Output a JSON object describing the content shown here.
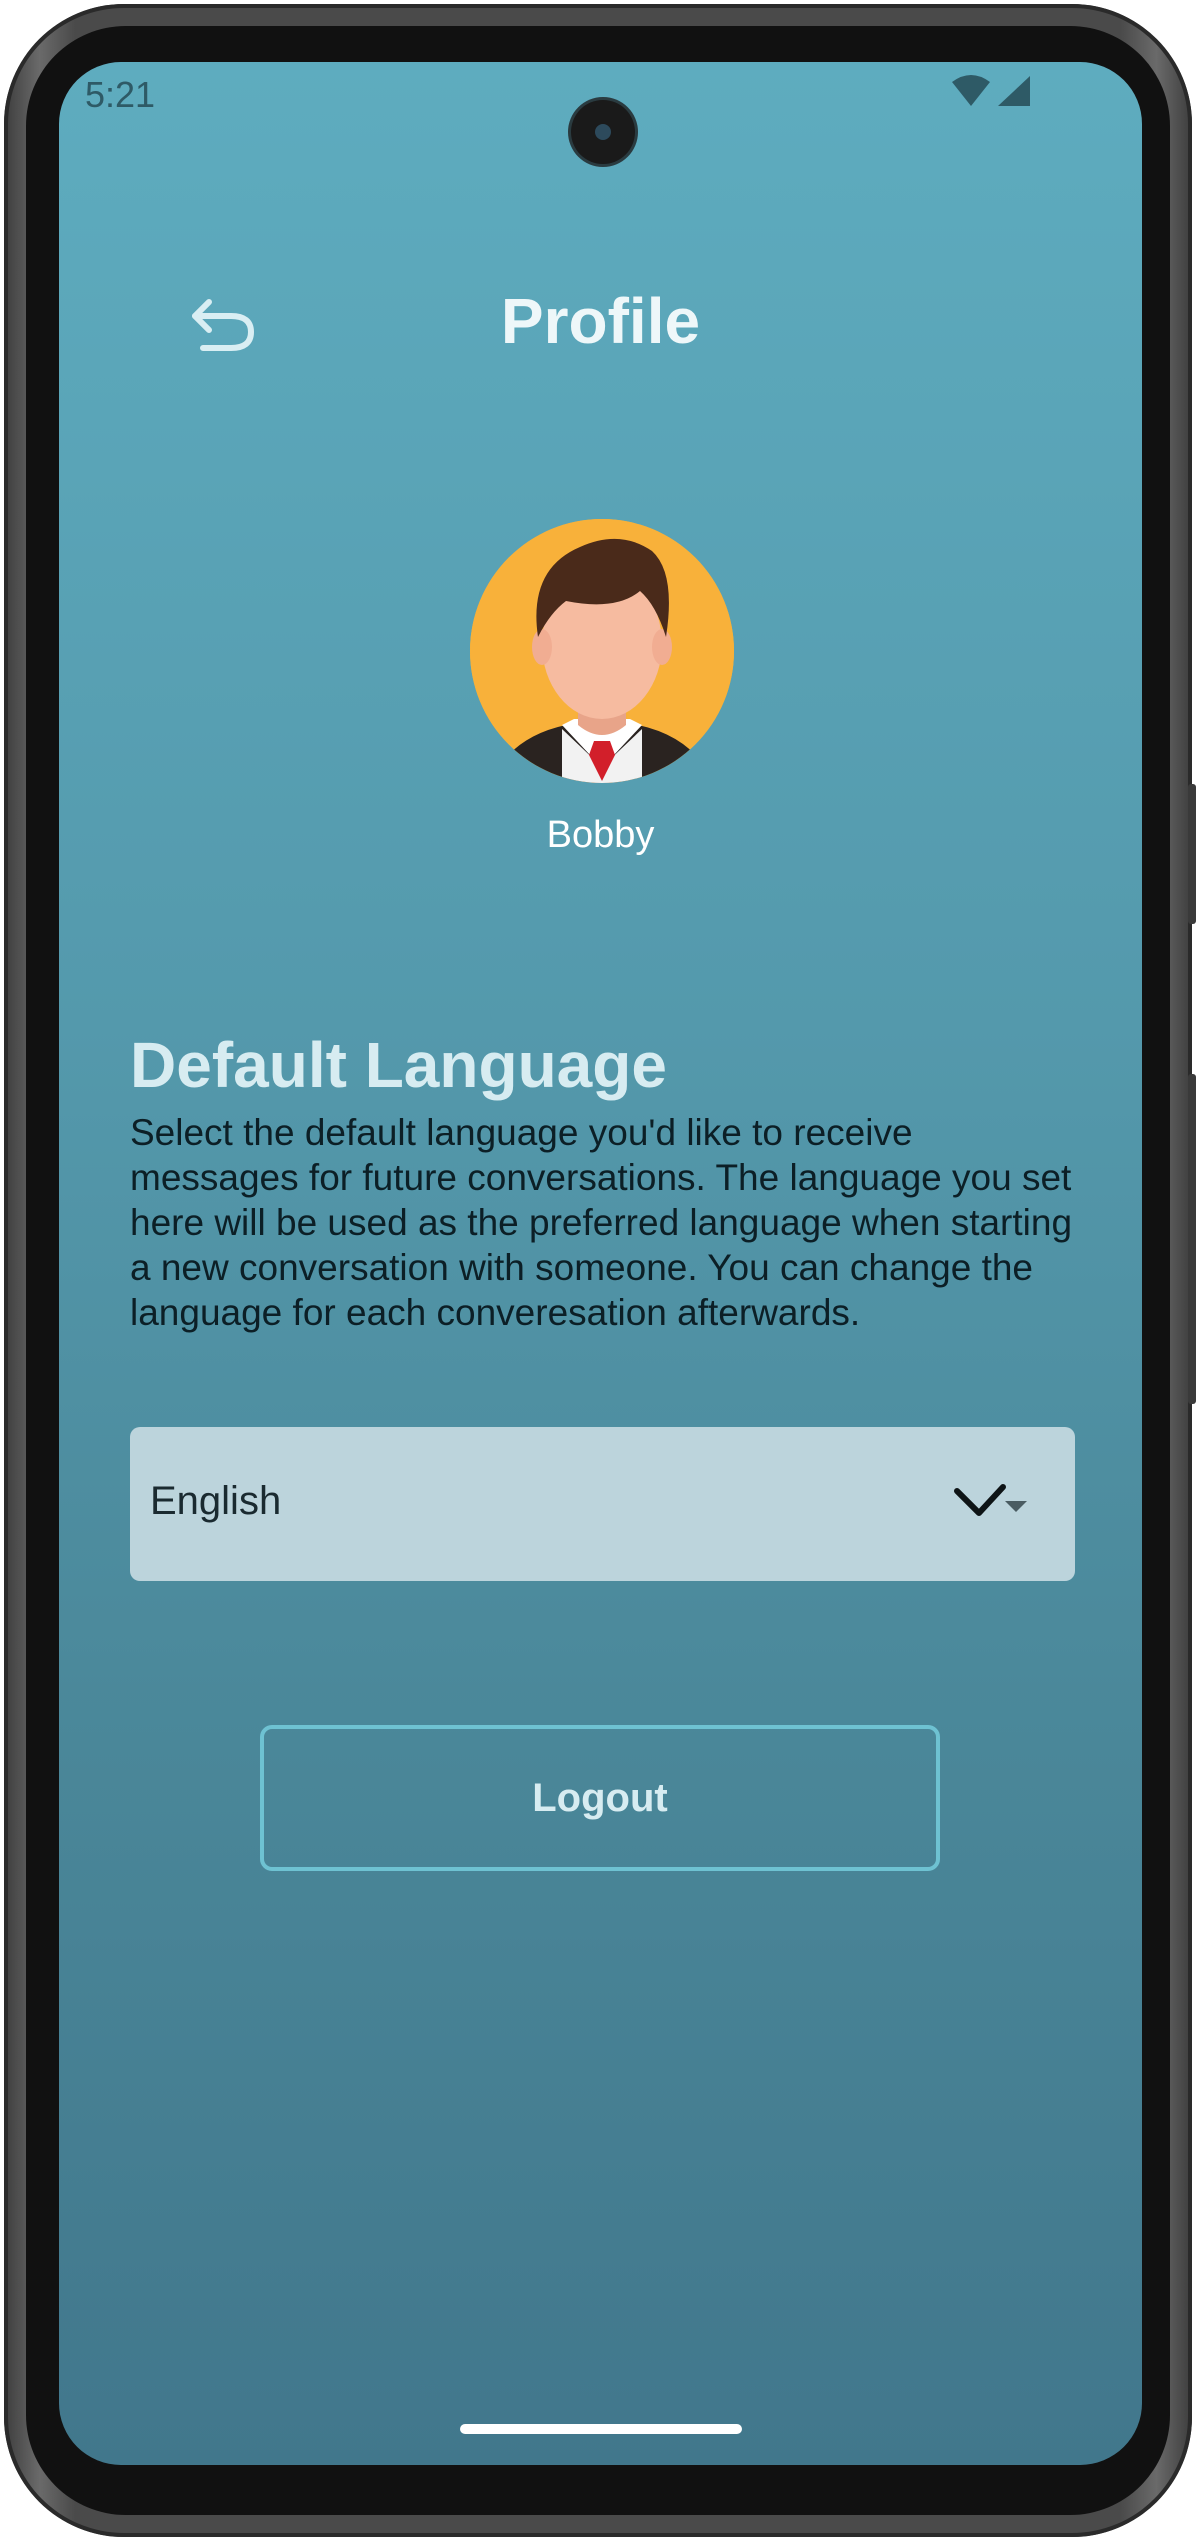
{
  "status_bar": {
    "time": "5:21"
  },
  "header": {
    "title": "Profile",
    "back_icon": "back-arrow-icon"
  },
  "profile": {
    "name": "Bobby",
    "avatar_icon": "avatar-icon"
  },
  "language_section": {
    "title": "Default Language",
    "description": "Select the default language you'd like to receive messages for future conversations. The language you set here will be used as the preferred language when starting a new conversation with someone. You can change the language for each converesation afterwards.",
    "selected_value": "English",
    "chevron_icon": "chevron-down-icon"
  },
  "actions": {
    "logout_label": "Logout"
  },
  "colors": {
    "background_top": "#5eacbf",
    "background_bottom": "#41778c",
    "select_fill": "#bcd4dc",
    "button_border": "#6ec2d2",
    "avatar_bg": "#f8b13a"
  }
}
